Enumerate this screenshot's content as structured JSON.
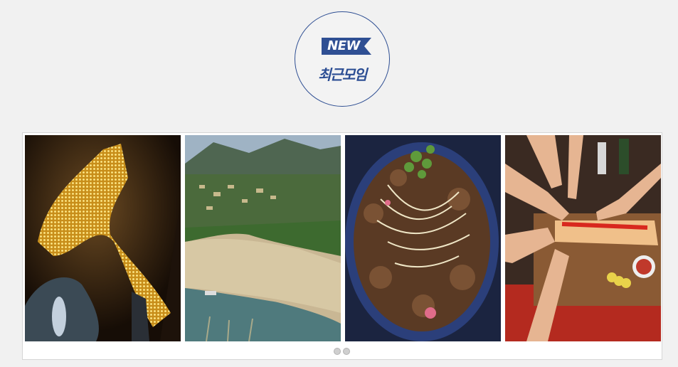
{
  "badge": {
    "ribbon_text": "NEW",
    "title": "최근모임",
    "accent_color": "#2f4f93"
  },
  "carousel": {
    "slides": [
      {
        "name": "slide-cave-lights"
      },
      {
        "name": "slide-river-village"
      },
      {
        "name": "slide-bulgogi-noodles"
      },
      {
        "name": "slide-group-dinner"
      }
    ],
    "dot_count": 2
  }
}
